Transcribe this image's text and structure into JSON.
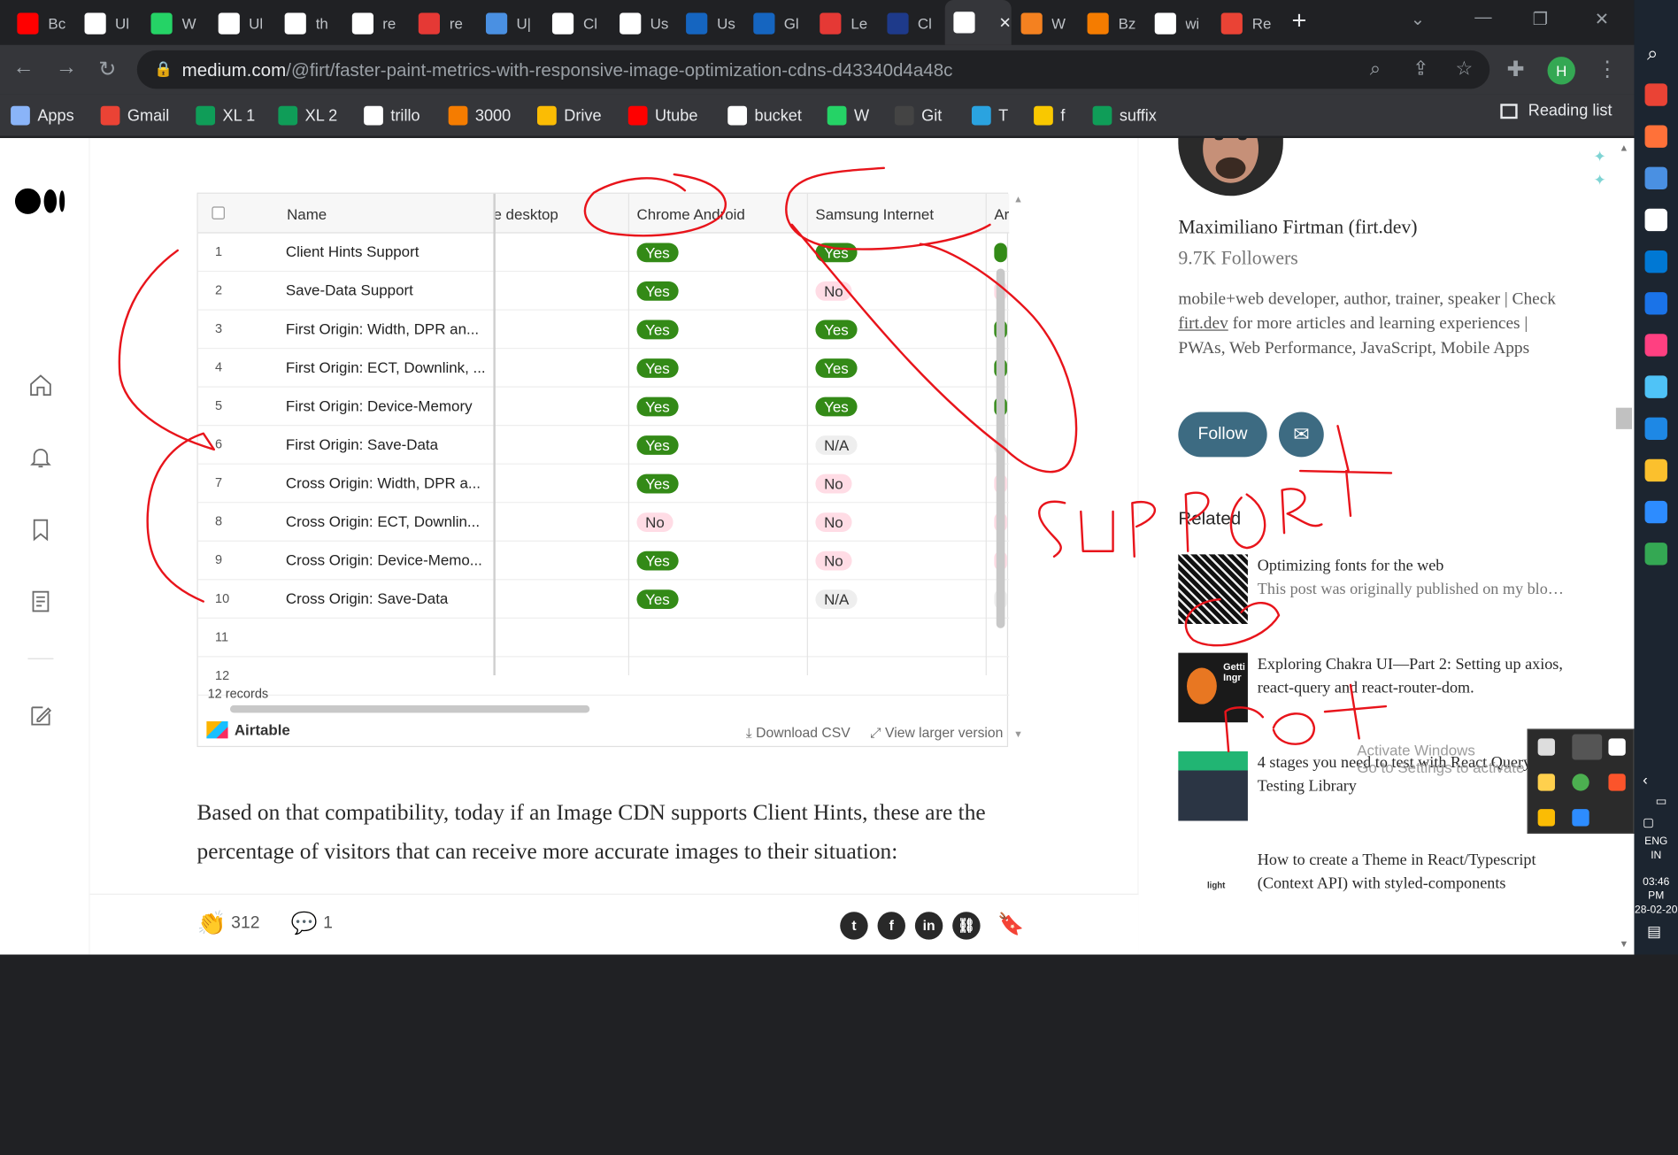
{
  "tabs": [
    {
      "title": "Bc",
      "color": "#ff0000"
    },
    {
      "title": "Ul",
      "color": "#ffffff"
    },
    {
      "title": "W",
      "color": "#25d366"
    },
    {
      "title": "Ul",
      "color": "#ffffff"
    },
    {
      "title": "th",
      "color": "#ffffff"
    },
    {
      "title": "re",
      "color": "#ffffff"
    },
    {
      "title": "re",
      "color": "#e53935"
    },
    {
      "title": "U|",
      "color": "#4a90e2"
    },
    {
      "title": "Cl",
      "color": "#ffffff"
    },
    {
      "title": "Us",
      "color": "#ffffff"
    },
    {
      "title": "Us",
      "color": "#1565c0"
    },
    {
      "title": "Gl",
      "color": "#1565c0"
    },
    {
      "title": "Le",
      "color": "#e53935"
    },
    {
      "title": "Cl",
      "color": "#1e3a8a"
    },
    {
      "title": "",
      "color": "#ffffff"
    },
    {
      "title": "W",
      "color": "#f48120"
    },
    {
      "title": "Bz",
      "color": "#f57c00"
    },
    {
      "title": "wi",
      "color": "#ffffff"
    },
    {
      "title": "Re",
      "color": "#ea4335"
    }
  ],
  "address": {
    "domain": "medium.com",
    "path": "/@firt/faster-paint-metrics-with-responsive-image-optimization-cdns-d43340d4a48c"
  },
  "profile_initial": "H",
  "bookmarks": [
    {
      "label": "Apps",
      "color": "#8ab4f8"
    },
    {
      "label": "Gmail",
      "color": "#ea4335"
    },
    {
      "label": "XL 1",
      "color": "#0f9d58"
    },
    {
      "label": "XL 2",
      "color": "#0f9d58"
    },
    {
      "label": "trillo",
      "color": "#ffffff"
    },
    {
      "label": "3000",
      "color": "#f57c00"
    },
    {
      "label": "Drive",
      "color": "#fbbc04"
    },
    {
      "label": "Utube",
      "color": "#ff0000"
    },
    {
      "label": "bucket",
      "color": "#ffffff"
    },
    {
      "label": "W",
      "color": "#25d366"
    },
    {
      "label": "Git",
      "color": "#444444"
    },
    {
      "label": "T",
      "color": "#2aa3e0"
    },
    {
      "label": "f",
      "color": "#f9c800"
    },
    {
      "label": "suffix",
      "color": "#0f9d58"
    }
  ],
  "reading_list": "Reading list",
  "table": {
    "columns": {
      "name": "Name",
      "desktop": "e desktop",
      "chrome": "Chrome Android",
      "samsung": "Samsung Internet",
      "extra": "Ar"
    },
    "rows": [
      {
        "n": "1",
        "name": "Client Hints Support",
        "chrome": "Yes",
        "samsung": "Yes"
      },
      {
        "n": "2",
        "name": "Save-Data Support",
        "chrome": "Yes",
        "samsung": "No"
      },
      {
        "n": "3",
        "name": "First Origin: Width, DPR an...",
        "chrome": "Yes",
        "samsung": "Yes"
      },
      {
        "n": "4",
        "name": "First Origin: ECT, Downlink, ...",
        "chrome": "Yes",
        "samsung": "Yes"
      },
      {
        "n": "5",
        "name": "First Origin: Device-Memory",
        "chrome": "Yes",
        "samsung": "Yes"
      },
      {
        "n": "6",
        "name": "First Origin: Save-Data",
        "chrome": "Yes",
        "samsung": "N/A"
      },
      {
        "n": "7",
        "name": "Cross Origin: Width, DPR a...",
        "chrome": "Yes",
        "samsung": "No"
      },
      {
        "n": "8",
        "name": "Cross Origin: ECT, Downlin...",
        "chrome": "No",
        "samsung": "No"
      },
      {
        "n": "9",
        "name": "Cross Origin: Device-Memo...",
        "chrome": "Yes",
        "samsung": "No"
      },
      {
        "n": "10",
        "name": "Cross Origin: Save-Data",
        "chrome": "Yes",
        "samsung": "N/A"
      },
      {
        "n": "11",
        "name": "",
        "chrome": "",
        "samsung": ""
      },
      {
        "n": "12",
        "name": "",
        "chrome": "",
        "samsung": ""
      }
    ],
    "records": "12 records",
    "brand": "Airtable",
    "download": "Download CSV",
    "view_larger": "View larger version"
  },
  "article_text": "Based on that compatibility, today if an Image CDN supports Client Hints, these are the percentage of visitors that can receive more accurate images to their situation:",
  "claps": "312",
  "responses": "1",
  "author": {
    "name": "Maximiliano Firtman (firt.dev)",
    "followers": "9.7K Followers",
    "bio_pre": "mobile+web developer, author, trainer, speaker | Check ",
    "bio_link": "firt.dev",
    "bio_post": " for more articles and learning experiences | PWAs, Web Performance, JavaScript, Mobile Apps",
    "follow": "Follow"
  },
  "related_heading": "Related",
  "related": [
    {
      "title": "Optimizing fonts for the web",
      "sub": "This post was originally published on my blo…"
    },
    {
      "title": "Exploring Chakra UI—Part 2: Setting up axios, react-query and react-router-dom.",
      "sub": ""
    },
    {
      "title": "4 stages you need to test with React Query and Testing Library",
      "sub": ""
    },
    {
      "title": "How to create a Theme in React/Typescript (Context API) with styled-components",
      "sub": ""
    }
  ],
  "activate_windows": "Activate Windows\nGo to Settings to activate Windows.",
  "clock": {
    "lang": "ENG",
    "region": "IN",
    "time": "03:46 PM",
    "date": "28-02-20"
  },
  "ink_words": [
    "SUPPORT",
    "not"
  ],
  "colors": {
    "ink": "#e8141b",
    "yes": "#338a17",
    "no": "#ffdce5",
    "follow": "#3d6b82"
  }
}
